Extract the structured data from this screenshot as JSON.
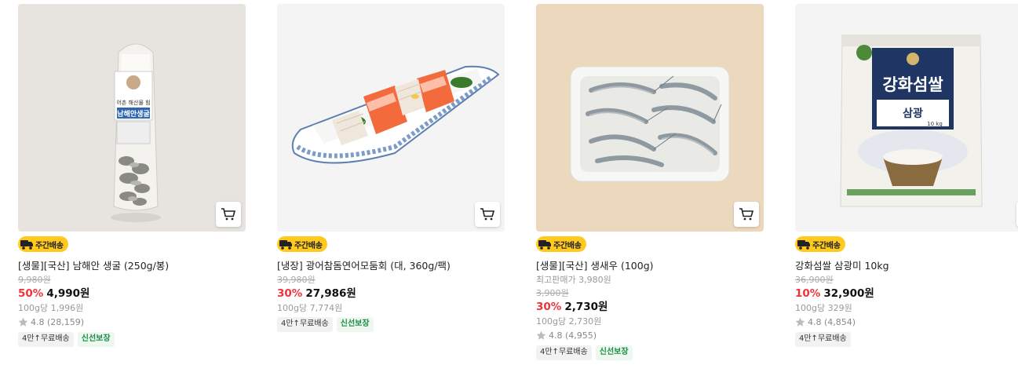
{
  "delivery_badge": "주간배송",
  "products": [
    {
      "name": "[생물][국산] 남해안 생굴 (250g/봉)",
      "min_price_label": "",
      "original_price": "9,980원",
      "discount_rate": "50%",
      "price": "4,990원",
      "unit_price": "100g당 1,996원",
      "rating": "4.8 (28,159)",
      "tags": [
        "4만↑무료배송",
        "신선보장"
      ],
      "package_text": "남해안생굴",
      "brand_text": "어촌 해산물 힘"
    },
    {
      "name": "[냉장] 광어참돔연어모둠회 (대, 360g/팩)",
      "min_price_label": "",
      "original_price": "39,980원",
      "discount_rate": "30%",
      "price": "27,986원",
      "unit_price": "100g당 7,774원",
      "rating": "",
      "tags": [
        "4만↑무료배송",
        "신선보장"
      ]
    },
    {
      "name": "[생물][국산] 생새우 (100g)",
      "min_price_label": "최고판매가 3,980원",
      "original_price": "3,900원",
      "discount_rate": "30%",
      "price": "2,730원",
      "unit_price": "100g당 2,730원",
      "rating": "4.8 (4,955)",
      "tags": [
        "4만↑무료배송",
        "신선보장"
      ]
    },
    {
      "name": "강화섬쌀 삼광미 10kg",
      "min_price_label": "",
      "original_price": "36,900원",
      "discount_rate": "10%",
      "price": "32,900원",
      "unit_price": "100g당 329원",
      "rating": "4.8 (4,854)",
      "tags": [
        "4만↑무료배송"
      ],
      "package_text": "강화섬쌀",
      "variety_text": "삼광",
      "weight_text": "10 kg"
    }
  ],
  "colors": {
    "badge_yellow": "#ffc91e",
    "discount_red": "#f0333b",
    "fresh_green": "#1a8f43",
    "star_gray": "#bbbbbb"
  }
}
